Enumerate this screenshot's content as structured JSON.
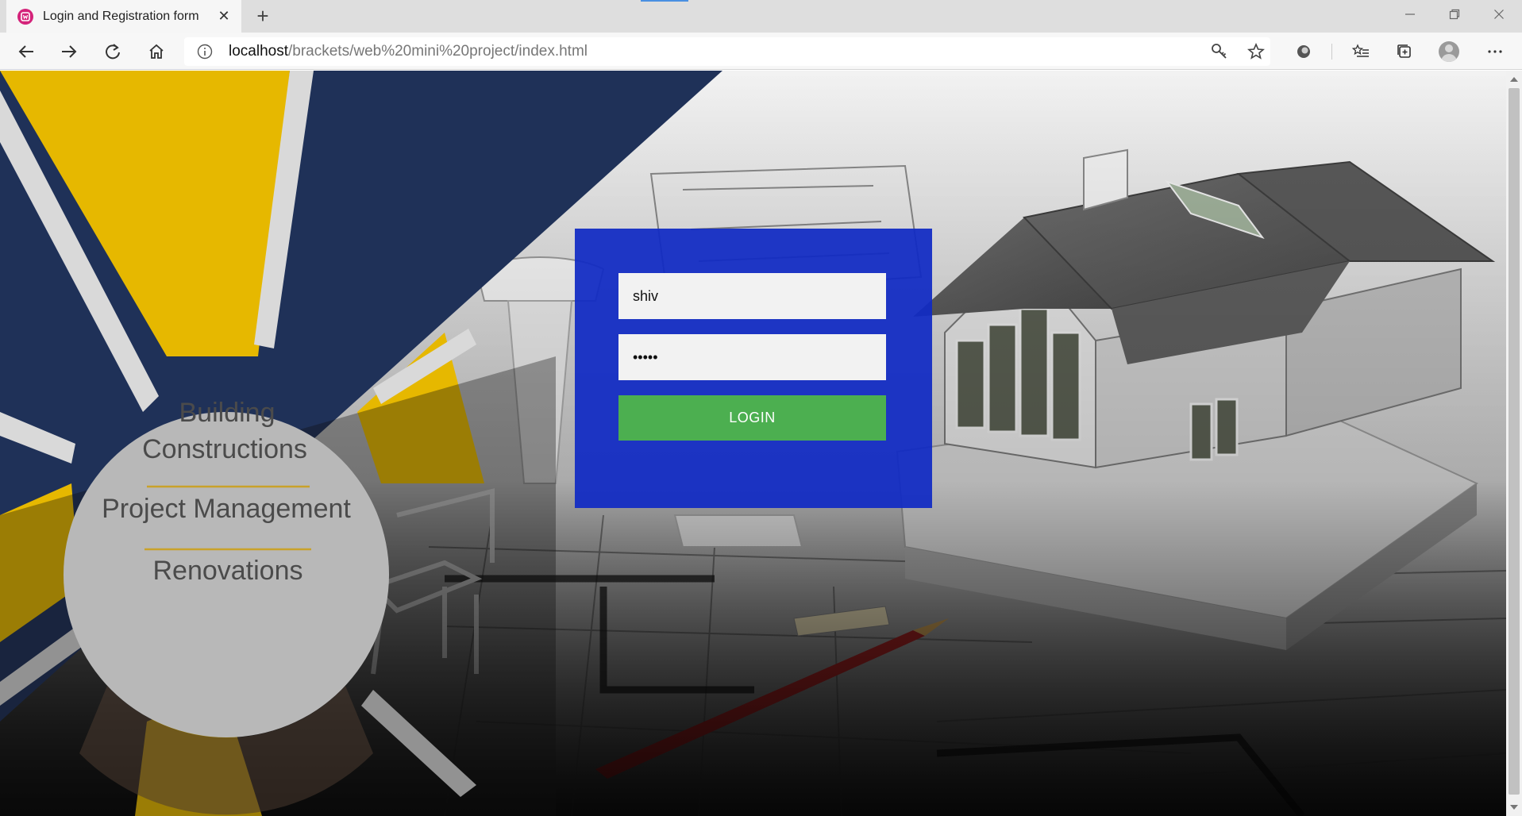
{
  "browser": {
    "tab_title": "Login and Registration form",
    "url_host": "localhost",
    "url_path": "/brackets/web%20mini%20project/index.html"
  },
  "hero": {
    "line1": "Building",
    "line2": "Constructions",
    "line3": "Project Management",
    "line4": "Renovations",
    "colors": {
      "navy": "#1f3158",
      "gold": "#e6b800",
      "paper": "#e9e9e9"
    }
  },
  "login": {
    "username_value": "shiv",
    "password_value": "shiv1",
    "button_label": "LOGIN",
    "box_color": "#1029c4",
    "button_color": "#4caf50"
  }
}
